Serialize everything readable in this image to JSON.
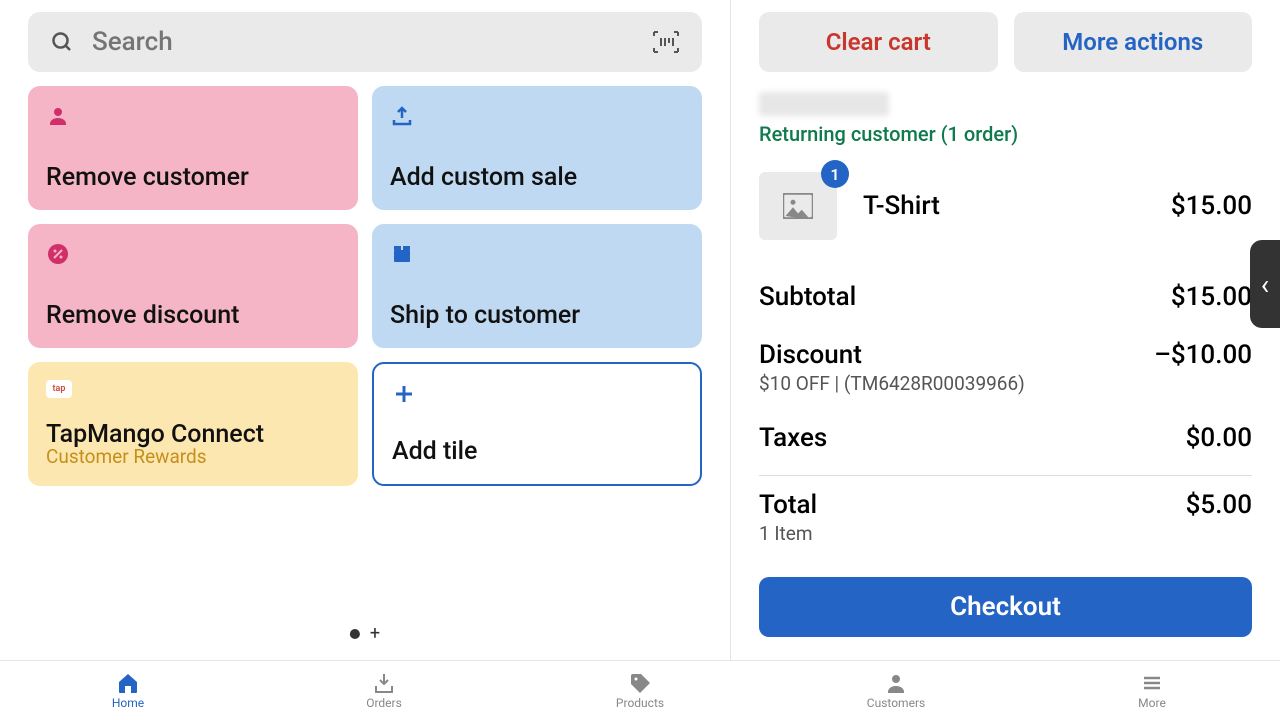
{
  "search": {
    "placeholder": "Search"
  },
  "tiles": {
    "remove_customer": "Remove customer",
    "add_custom_sale": "Add custom sale",
    "remove_discount": "Remove discount",
    "ship_to_customer": "Ship to customer",
    "tapmango_title": "TapMango Connect",
    "tapmango_sub": "Customer Rewards",
    "tapmango_badge": "tap",
    "add_tile": "Add tile"
  },
  "cart": {
    "clear_label": "Clear cart",
    "more_label": "More actions",
    "customer_status": "Returning customer (1 order)",
    "item": {
      "qty": "1",
      "name": "T-Shirt",
      "price": "$15.00"
    },
    "subtotal_label": "Subtotal",
    "subtotal_val": "$15.00",
    "discount_label": "Discount",
    "discount_sub": "$10 OFF | (TM6428R00039966)",
    "discount_val": "–$10.00",
    "taxes_label": "Taxes",
    "taxes_val": "$0.00",
    "total_label": "Total",
    "total_sub": "1 Item",
    "total_val": "$5.00",
    "checkout_label": "Checkout"
  },
  "nav": {
    "home": "Home",
    "orders": "Orders",
    "products": "Products",
    "customers": "Customers",
    "more": "More"
  }
}
